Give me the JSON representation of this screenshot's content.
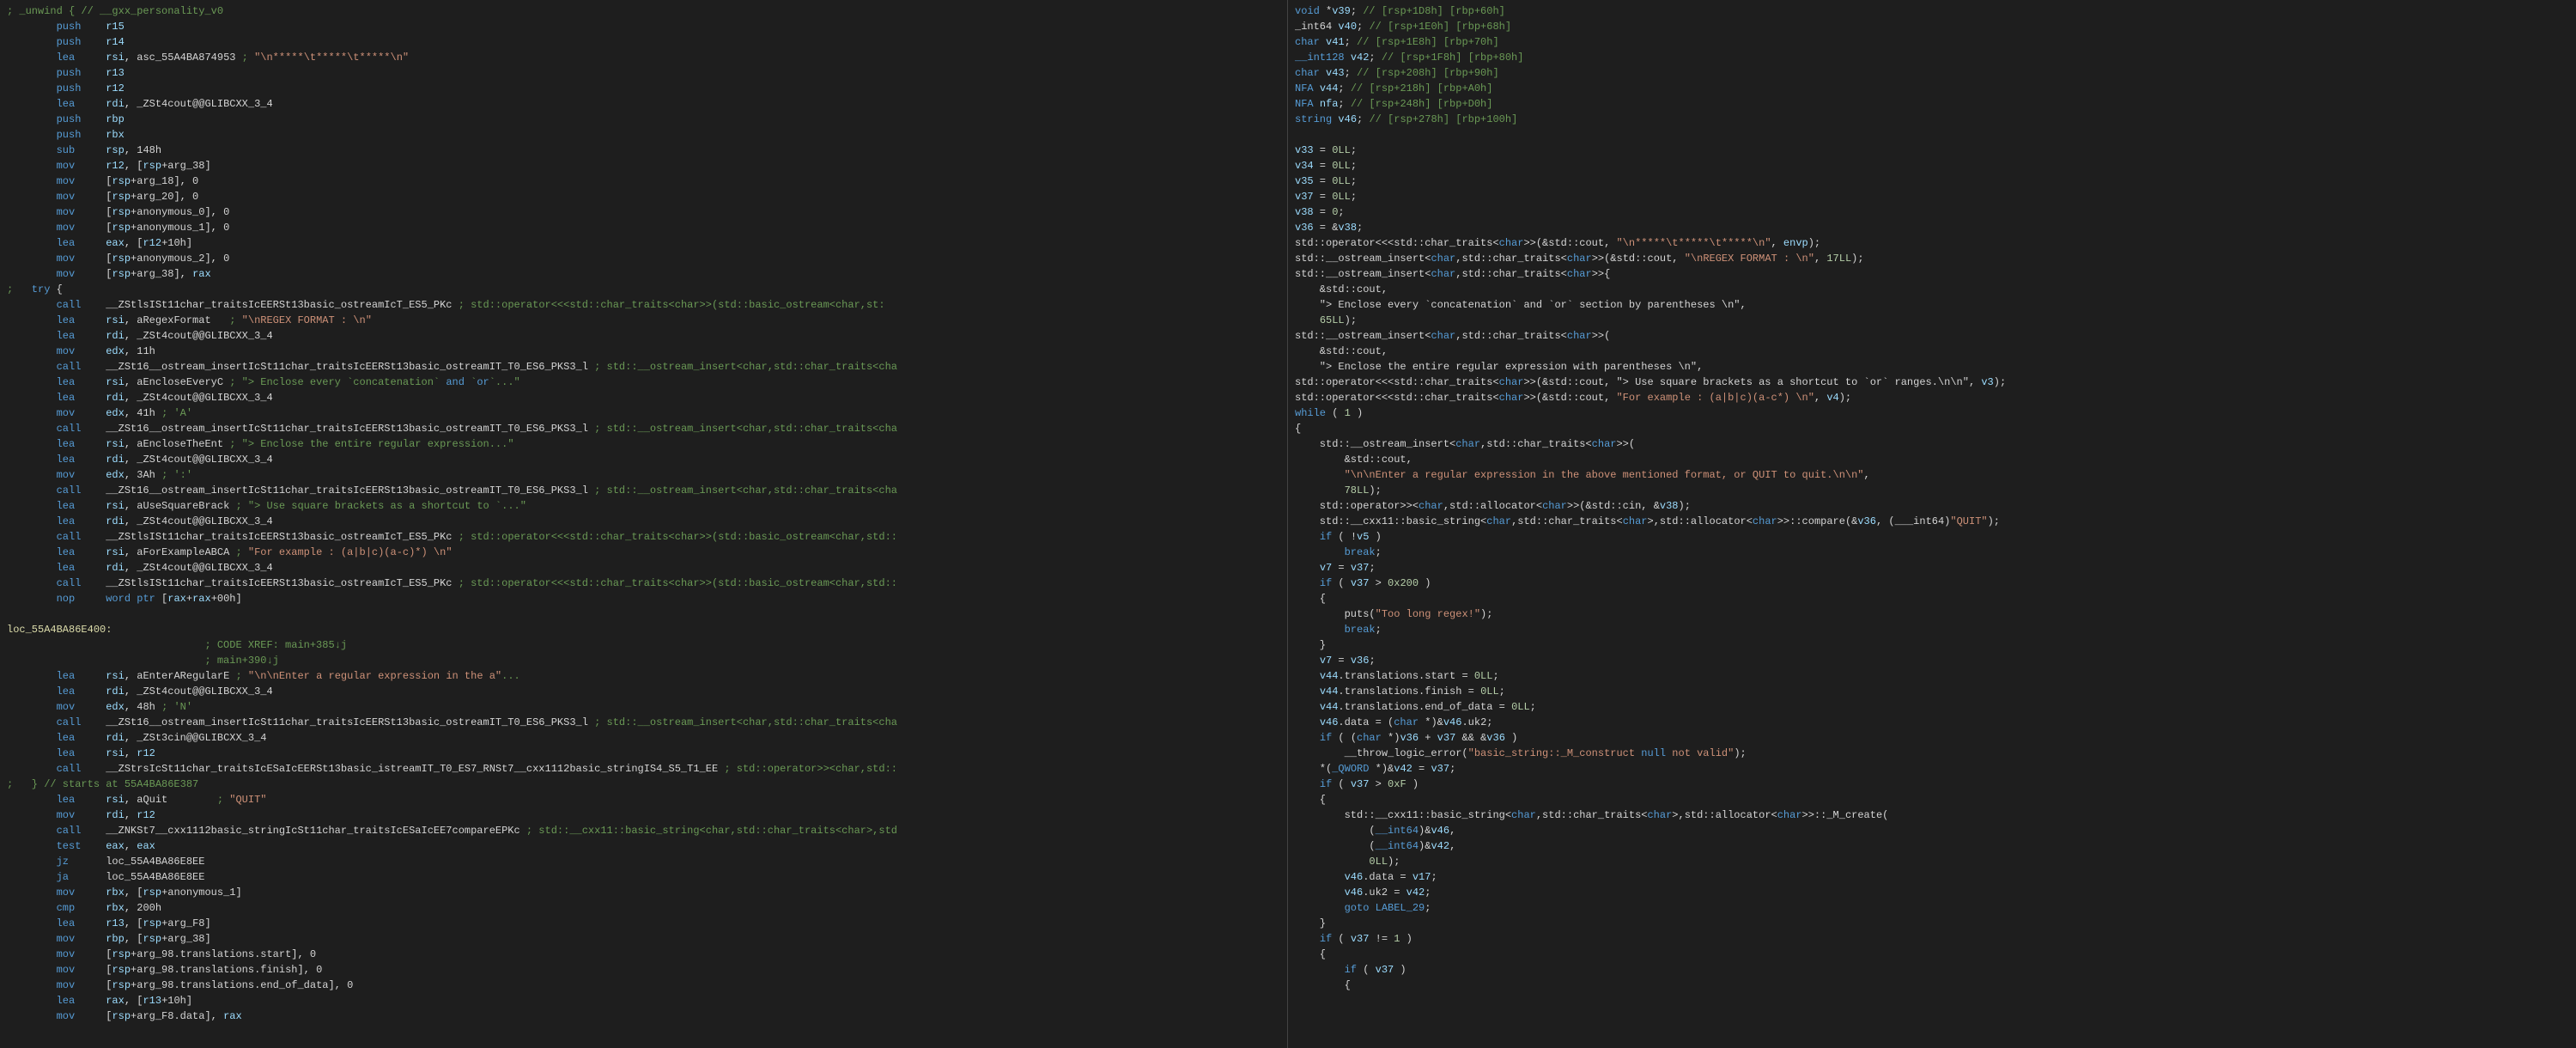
{
  "left_code": [
    "; _unwind { // __gxx_personality_v0",
    "        push    r15",
    "        push    r14",
    "        lea     rsi, asc_55A4BA874953 ; \"\\n*****\\t*****\\t*****\\n\"",
    "        push    r13",
    "        push    r12",
    "        lea     rdi, _ZSt4cout@@GLIBCXX_3_4",
    "        push    rbp",
    "        push    rbx",
    "        sub     rsp, 148h",
    "        mov     r12, [rsp+arg_38]",
    "        mov     [rsp+arg_18], 0",
    "        mov     [rsp+arg_20], 0",
    "        mov     [rsp+anonymous_0], 0",
    "        mov     [rsp+anonymous_1], 0",
    "        lea     eax, [r12+10h]",
    "        mov     [rsp+anonymous_2], 0",
    "        mov     [rsp+arg_38], rax",
    ";   try {",
    "        call    __ZStlsISt11char_traitsIcEERSt13basic_ostreamIcT_ES5_PKc ; std::operator<<<std::char_traits<char>>(std::basic_ostream<char,st:",
    "        lea     rsi, aRegexFormat   ; \"\\nREGEX FORMAT : \\n\"",
    "        lea     rdi, _ZSt4cout@@GLIBCXX_3_4",
    "        mov     edx, 11h",
    "        call    __ZSt16__ostream_insertIcSt11char_traitsIcEERSt13basic_ostreamIT_T0_ES6_PKS3_l ; std::__ostream_insert<char,std::char_traits<cha",
    "        lea     rsi, aEncloseEveryC ; \"> Enclose every `concatenation` and `or`...\"",
    "        lea     rdi, _ZSt4cout@@GLIBCXX_3_4",
    "        mov     edx, 41h ; 'A'",
    "        call    __ZSt16__ostream_insertIcSt11char_traitsIcEERSt13basic_ostreamIT_T0_ES6_PKS3_l ; std::__ostream_insert<char,std::char_traits<cha",
    "        lea     rsi, aEncloseTheEnt ; \"> Enclose the entire regular expression...\"",
    "        lea     rdi, _ZSt4cout@@GLIBCXX_3_4",
    "        mov     edx, 3Ah ; ':'",
    "        call    __ZSt16__ostream_insertIcSt11char_traitsIcEERSt13basic_ostreamIT_T0_ES6_PKS3_l ; std::__ostream_insert<char,std::char_traits<cha",
    "        lea     rsi, aUseSquareBrack ; \"> Use square brackets as a shortcut to `...\"",
    "        lea     rdi, _ZSt4cout@@GLIBCXX_3_4",
    "        call    __ZStlsISt11char_traitsIcEERSt13basic_ostreamIcT_ES5_PKc ; std::operator<<<std::char_traits<char>>(std::basic_ostream<char,std::",
    "        lea     rsi, aForExampleABCA ; \"For example : (a|b|c)(a-c)*) \\n\"",
    "        lea     rdi, _ZSt4cout@@GLIBCXX_3_4",
    "        call    __ZStlsISt11char_traitsIcEERSt13basic_ostreamIcT_ES5_PKc ; std::operator<<<std::char_traits<char>>(std::basic_ostream<char,std::",
    "        nop     word ptr [rax+rax+00h]",
    "",
    "loc_55A4BA86E400:",
    "                                ; CODE XREF: main+385↓j",
    "                                ; main+390↓j",
    "        lea     rsi, aEnterARegularE ; \"\\n\\nEnter a regular expression in the a\"...",
    "        lea     rdi, _ZSt4cout@@GLIBCXX_3_4",
    "        mov     edx, 48h ; 'N'",
    "        call    __ZSt16__ostream_insertIcSt11char_traitsIcEERSt13basic_ostreamIT_T0_ES6_PKS3_l ; std::__ostream_insert<char,std::char_traits<cha",
    "        lea     rdi, _ZSt3cin@@GLIBCXX_3_4",
    "        lea     rsi, r12",
    "        call    __ZStrsIcSt11char_traitsIcESaIcEERSt13basic_istreamIT_T0_ES7_RNSt7__cxx1112basic_stringIS4_S5_T1_EE ; std::operator>><char,std::",
    ";   } // starts at 55A4BA86E387",
    "        lea     rsi, aQuit        ; \"QUIT\"",
    "        mov     rdi, r12",
    "        call    __ZNKSt7__cxx1112basic_stringIcSt11char_traitsIcESaIcEE7compareEPKc ; std::__cxx11::basic_string<char,std::char_traits<char>,std",
    "        test    eax, eax",
    "        jz      loc_55A4BA86E8EE",
    "        ja      loc_55A4BA86E8EE",
    "        mov     rbx, [rsp+anonymous_1]",
    "        cmp     rbx, 200h",
    "        lea     r13, [rsp+arg_F8]",
    "        mov     rbp, [rsp+arg_38]",
    "        mov     [rsp+arg_98.translations.start], 0",
    "        mov     [rsp+arg_98.translations.finish], 0",
    "        mov     [rsp+arg_98.translations.end_of_data], 0",
    "        lea     rax, [r13+10h]",
    "        mov     [rsp+arg_F8.data], rax"
  ],
  "right_code": [
    "void *v39; // [rsp+1D8h] [rbp+60h]",
    "_int64 v40; // [rsp+1E0h] [rbp+68h]",
    "char v41; // [rsp+1E8h] [rbp+70h]",
    "__int128 v42; // [rsp+1F8h] [rbp+80h]",
    "char v43; // [rsp+208h] [rbp+90h]",
    "NFA v44; // [rsp+218h] [rbp+A0h]",
    "NFA nfa; // [rsp+248h] [rbp+D0h]",
    "string v46; // [rsp+278h] [rbp+100h]",
    "",
    "v33 = 0LL;",
    "v34 = 0LL;",
    "v35 = 0LL;",
    "v37 = 0LL;",
    "v38 = 0;",
    "v36 = &v38;",
    "std::operator<<<std::char_traits<char>>(&std::cout, \"\\n*****\\t*****\\t*****\\n\", envp);",
    "std::__ostream_insert<char,std::char_traits<char>>(&std::cout, \"\\nREGEX FORMAT : \\n\", 17LL);",
    "std::__ostream_insert<char,std::char_traits<char>>{",
    "    &std::cout,",
    "    \"> Enclose every `concatenation` and `or` section by parentheses \\n\",",
    "    65LL);",
    "std::__ostream_insert<char,std::char_traits<char>>(",
    "    &std::cout,",
    "    \"> Enclose the entire regular expression with parentheses \\n\",",
    "std::operator<<<std::char_traits<char>>(&std::cout, \"> Use square brackets as a shortcut to `or` ranges.\\n\\n\", v3);",
    "std::operator<<<std::char_traits<char>>(&std::cout, \"For example : (a|b|c)(a-c*) \\n\", v4);",
    "while ( 1 )",
    "{",
    "    std::__ostream_insert<char,std::char_traits<char>>(",
    "        &std::cout,",
    "        \"\\n\\nEnter a regular expression in the above mentioned format, or QUIT to quit.\\n\\n\",",
    "        78LL);",
    "    std::operator>><char,std::allocator<char>>(&std::cin, &v38);",
    "    std::__cxx11::basic_string<char,std::char_traits<char>,std::allocator<char>>::compare(&v36, (___int64)\"QUIT\");",
    "    if ( !v5 )",
    "        break;",
    "    v7 = v37;",
    "    if ( v37 > 0x200 )",
    "    {",
    "        puts(\"Too long regex!\");",
    "        break;",
    "    }",
    "    v7 = v36;",
    "    v44.translations.start = 0LL;",
    "    v44.translations.finish = 0LL;",
    "    v44.translations.end_of_data = 0LL;",
    "    v46.data = (char *)&v46.uk2;",
    "    if ( (char *)v36 + v37 && &v36 )",
    "        __throw_logic_error(\"basic_string::_M_construct null not valid\");",
    "    *(_QWORD *)&v42 = v37;",
    "    if ( v37 > 0xF )",
    "    {",
    "        std::__cxx11::basic_string<char,std::char_traits<char>,std::allocator<char>>::_M_create(",
    "            (__int64)&v46,",
    "            (__int64)&v42,",
    "            0LL);",
    "        v46.data = v17;",
    "        v46.uk2 = v42;",
    "        goto LABEL_29;",
    "    }",
    "    if ( v37 != 1 )",
    "    {",
    "        if ( v37 )",
    "        {"
  ]
}
